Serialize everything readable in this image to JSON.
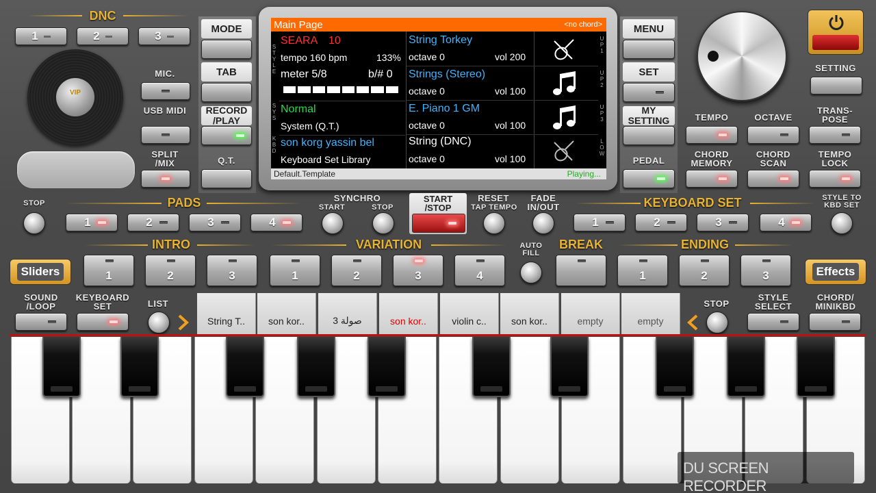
{
  "dnc": {
    "title": "DNC",
    "buttons": [
      "1",
      "2",
      "3"
    ],
    "disc_label": "VIP"
  },
  "left": {
    "mic": "MIC.",
    "usb_midi": "USB MIDI",
    "split_mix": "SPLIT /MIX"
  },
  "col1": {
    "mode": "MODE",
    "tab": "TAB",
    "record_play": "RECORD /PLAY",
    "qt": "Q.T."
  },
  "col2": {
    "menu": "MENU",
    "set": "SET",
    "my_setting": "MY SETTING",
    "pedal": "PEDAL"
  },
  "display": {
    "header_title": "Main Page",
    "header_chord": "<no chord>",
    "left_tags": [
      "STYLE",
      "SYS",
      "KBD"
    ],
    "right_tags": [
      "UP1",
      "UP2",
      "UP3",
      "LOW"
    ],
    "style": {
      "name": "SEARA",
      "num": "10",
      "tempo": "tempo 160 bpm",
      "percent": "133%",
      "meter": "meter 5/8",
      "bsharp": "b/# 0"
    },
    "sys": {
      "name": "Normal",
      "sub": "System (Q.T.)"
    },
    "kbd": {
      "name": "son korg yassin bel",
      "sub": "Keyboard Set Library"
    },
    "tracks": [
      {
        "name": "String Torkey",
        "octave": "octave 0",
        "vol": "vol 200",
        "icon": "violin-icon"
      },
      {
        "name": "Strings (Stereo)",
        "octave": "octave 0",
        "vol": "vol 100",
        "icon": "music-note-icon"
      },
      {
        "name": "E. Piano 1 GM",
        "octave": "octave 0",
        "vol": "vol 100",
        "icon": "music-note-icon"
      },
      {
        "name": "String (DNC)",
        "octave": "octave 0",
        "vol": "vol 100",
        "icon": "violin-icon"
      }
    ],
    "footer_left": "Default.Template",
    "footer_right": "Playing..."
  },
  "right": {
    "setting": "SETTING",
    "tempo": "TEMPO",
    "octave": "OCTAVE",
    "transpose": "TRANS- POSE",
    "chord_memory": "CHORD MEMORY",
    "chord_scan": "CHORD SCAN",
    "tempo_lock": "TEMPO LOCK"
  },
  "pads": {
    "stop": "STOP",
    "title": "PADS",
    "buttons": [
      "1",
      "2",
      "3",
      "4"
    ]
  },
  "synchro": {
    "title": "SYNCHRO",
    "start": "START",
    "stop": "STOP"
  },
  "start_stop": "START /STOP",
  "reset": {
    "title": "RESET",
    "sub": "TAP TEMPO"
  },
  "fade": "FADE IN/OUT",
  "keyboard_set": {
    "title": "KEYBOARD SET",
    "buttons": [
      "1",
      "2",
      "3",
      "4"
    ],
    "style_to_kbd": "STYLE TO KBD SET"
  },
  "intro": {
    "title": "INTRO",
    "buttons": [
      "1",
      "2",
      "3"
    ]
  },
  "variation": {
    "title": "VARIATION",
    "buttons": [
      "1",
      "2",
      "3",
      "4"
    ]
  },
  "auto_fill": "AUTO FILL",
  "break": "BREAK",
  "ending": {
    "title": "ENDING",
    "buttons": [
      "1",
      "2",
      "3"
    ]
  },
  "sliders": "Sliders",
  "effects": "Effects",
  "bottom": {
    "sound_loop": "SOUND /LOOP",
    "keyboard_set": "KEYBOARD SET",
    "list": "LIST",
    "stop": "STOP",
    "style_select": "STYLE SELECT",
    "chord_minikbd": "CHORD/ MINIKBD"
  },
  "slots": [
    "String T..",
    "son kor..",
    "3 ﺻﻮﻟﺔ",
    "son kor..",
    "violin c..",
    "son kor..",
    "empty",
    "empty"
  ],
  "watermark": "DU SCREEN RECORDER",
  "colors": {
    "accent": "#e8b232",
    "display_header": "#ff6a00",
    "cyan_text": "#3fb4ff",
    "green_text": "#22dd44",
    "active_slot": "#e00000"
  }
}
